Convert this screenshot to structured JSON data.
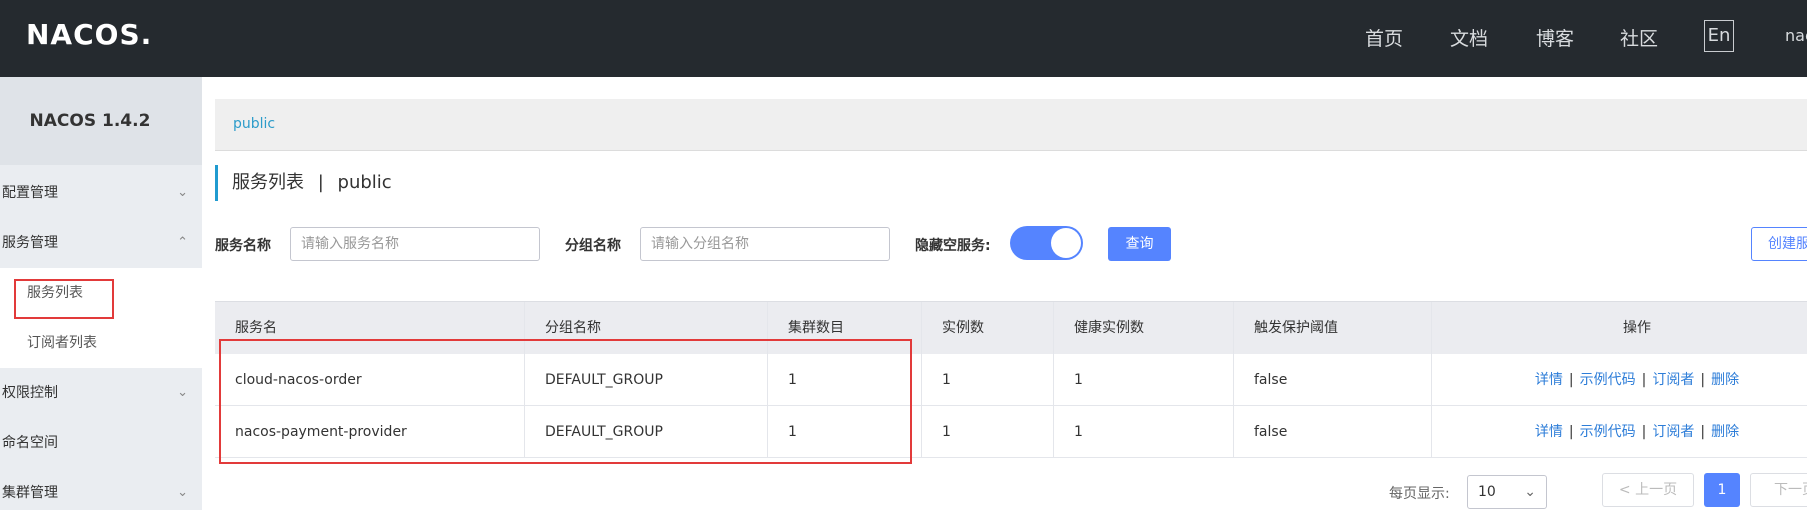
{
  "header": {
    "logo": "NACOS.",
    "nav": [
      "首页",
      "文档",
      "博客",
      "社区"
    ],
    "lang": "En",
    "user": "nacos"
  },
  "sidebar": {
    "title": "NACOS 1.4.2",
    "items": [
      {
        "label": "配置管理",
        "chevron": "chevron-down"
      },
      {
        "label": "服务管理",
        "chevron": "chevron-up"
      },
      {
        "label": "服务列表"
      },
      {
        "label": "订阅者列表"
      },
      {
        "label": "权限控制",
        "chevron": "chevron-down"
      },
      {
        "label": "命名空间"
      },
      {
        "label": "集群管理",
        "chevron": "chevron-down"
      }
    ]
  },
  "breadcrumb": "public",
  "page": {
    "title": "服务列表",
    "separator": "|",
    "namespace": "public"
  },
  "filters": {
    "service_name_label": "服务名称",
    "service_name_placeholder": "请输入服务名称",
    "group_name_label": "分组名称",
    "group_name_placeholder": "请输入分组名称",
    "hide_empty_label": "隐藏空服务:",
    "hide_empty_on": true,
    "query_button": "查询",
    "create_button": "创建服务"
  },
  "table": {
    "headers": [
      "服务名",
      "分组名称",
      "集群数目",
      "实例数",
      "健康实例数",
      "触发保护阈值",
      "操作"
    ],
    "rows": [
      {
        "service": "cloud-nacos-order",
        "group": "DEFAULT_GROUP",
        "clusters": "1",
        "instances": "1",
        "healthy": "1",
        "threshold": "false"
      },
      {
        "service": "nacos-payment-provider",
        "group": "DEFAULT_GROUP",
        "clusters": "1",
        "instances": "1",
        "healthy": "1",
        "threshold": "false"
      }
    ],
    "ops": [
      "详情",
      "示例代码",
      "订阅者",
      "删除"
    ]
  },
  "pagination": {
    "page_size_label": "每页显示:",
    "page_size": "10",
    "prev": "上一页",
    "current": "1",
    "next": "下一页"
  },
  "colors": {
    "header_bg": "#252a2f",
    "accent": "#5584ff",
    "highlight_border": "#e23a3a",
    "link": "#2d7dd8"
  }
}
